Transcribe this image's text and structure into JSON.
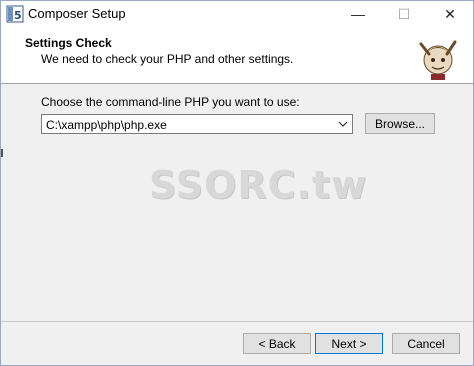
{
  "window": {
    "title": "Composer Setup",
    "minimize_glyph": "—",
    "maximize_glyph": "☐",
    "close_glyph": "✕"
  },
  "header": {
    "title": "Settings Check",
    "subtitle": "We need to check your PHP and other settings."
  },
  "main": {
    "choose_label": "Choose the command-line PHP you want to use:",
    "php_path_value": "C:\\xampp\\php\\php.exe",
    "browse_button": "Browse..."
  },
  "footer": {
    "back_button": "< Back",
    "next_button": "Next >",
    "cancel_button": "Cancel"
  },
  "watermark": "SSORC.tw",
  "icons": {
    "app": "composer-app-icon",
    "header_logo": "composer-conductor-logo",
    "combo_arrow": "chevron-down-icon"
  },
  "colors": {
    "title_bg": "#ffffff",
    "dialog_bg": "#f0f0f0",
    "default_button_border": "#0078d7",
    "button_bg": "#e1e1e1"
  }
}
